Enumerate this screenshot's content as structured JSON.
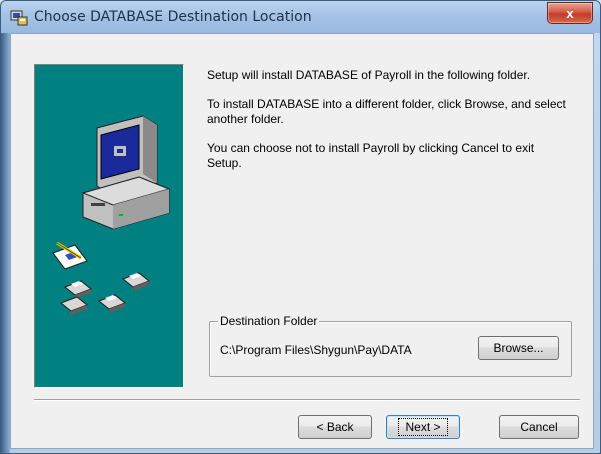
{
  "window": {
    "title": "Choose DATABASE Destination Location",
    "close_label": "x"
  },
  "messages": [
    "Setup will install DATABASE of Payroll in the following folder.",
    "To install DATABASE into a different folder, click Browse, and select another folder.",
    "You can choose not to install Payroll by clicking Cancel to exit Setup."
  ],
  "destination": {
    "group_label": "Destination Folder",
    "path": "C:\\Program Files\\Shygun\\Pay\\DATA",
    "browse_label": "Browse..."
  },
  "buttons": {
    "back": "< Back",
    "next": "Next >",
    "cancel": "Cancel"
  },
  "colors": {
    "art_background": "#008080",
    "dialog_background": "#f0f0f0"
  },
  "icons": {
    "app": "setup-icon",
    "art": "computer-with-disks-illustration"
  }
}
